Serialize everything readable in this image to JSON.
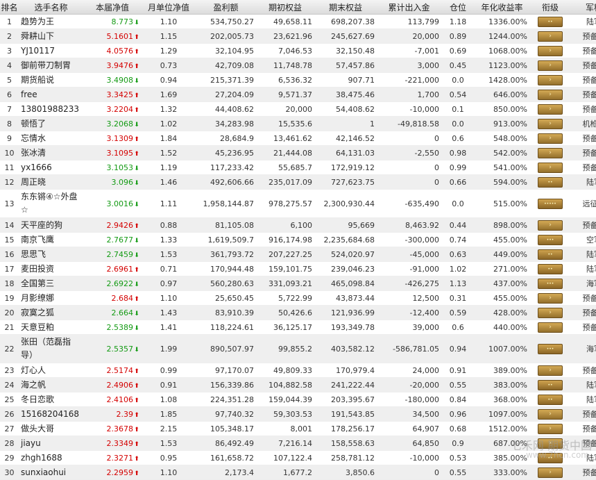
{
  "headers": [
    "排名",
    "选手名称",
    "本届净值",
    "月单位净值",
    "盈利额",
    "期初权益",
    "期末权益",
    "累计出入金",
    "仓位",
    "年化收益率",
    "衔级",
    "军种"
  ],
  "rows": [
    {
      "rank": "1",
      "name": "趋势为王",
      "nav": "8.773",
      "dir": "down",
      "monthly": "1.10",
      "profit": "534,750.27",
      "start": "49,658.11",
      "end": "698,207.38",
      "flow": "113,799",
      "position": "1.18",
      "annual": "1336.00%",
      "badge": "••",
      "branch": "陆军"
    },
    {
      "rank": "2",
      "name": "舜耕山下",
      "nav": "5.1601",
      "dir": "up",
      "monthly": "1.15",
      "profit": "202,005.73",
      "start": "23,621.96",
      "end": "245,627.69",
      "flow": "20,000",
      "position": "0.89",
      "annual": "1244.00%",
      "badge": "›",
      "branch": "预备役"
    },
    {
      "rank": "3",
      "name": "YJ10117",
      "nav": "4.0576",
      "dir": "up",
      "monthly": "1.29",
      "profit": "32,104.95",
      "start": "7,046.53",
      "end": "32,150.48",
      "flow": "-7,001",
      "position": "0.69",
      "annual": "1068.00%",
      "badge": "›",
      "branch": "预备役"
    },
    {
      "rank": "4",
      "name": "御前带刀制胃",
      "nav": "3.9476",
      "dir": "up",
      "monthly": "0.73",
      "profit": "42,709.08",
      "start": "11,748.78",
      "end": "57,457.86",
      "flow": "3,000",
      "position": "0.45",
      "annual": "1123.00%",
      "badge": "›",
      "branch": "预备役"
    },
    {
      "rank": "5",
      "name": "期货船说",
      "nav": "3.4908",
      "dir": "down",
      "monthly": "0.94",
      "profit": "215,371.39",
      "start": "6,536.32",
      "end": "907.71",
      "flow": "-221,000",
      "position": "0.0",
      "annual": "1428.00%",
      "badge": "›",
      "branch": "预备役"
    },
    {
      "rank": "6",
      "name": "free",
      "nav": "3.3425",
      "dir": "up",
      "monthly": "1.69",
      "profit": "27,204.09",
      "start": "9,571.37",
      "end": "38,475.46",
      "flow": "1,700",
      "position": "0.54",
      "annual": "646.00%",
      "badge": "›",
      "branch": "预备役"
    },
    {
      "rank": "7",
      "name": "13801988233",
      "nav": "3.2204",
      "dir": "up",
      "monthly": "1.32",
      "profit": "44,408.62",
      "start": "20,000",
      "end": "54,408.62",
      "flow": "-10,000",
      "position": "0.1",
      "annual": "850.00%",
      "badge": "›",
      "branch": "预备役"
    },
    {
      "rank": "8",
      "name": "顿悟了",
      "nav": "3.2068",
      "dir": "down",
      "monthly": "1.02",
      "profit": "34,283.98",
      "start": "15,535.6",
      "end": "1",
      "flow": "-49,818.58",
      "position": "0.0",
      "annual": "913.00%",
      "badge": "›",
      "branch": "机枪手"
    },
    {
      "rank": "9",
      "name": "忘情水",
      "nav": "3.1309",
      "dir": "up",
      "monthly": "1.84",
      "profit": "28,684.9",
      "start": "13,461.62",
      "end": "42,146.52",
      "flow": "0",
      "position": "0.6",
      "annual": "548.00%",
      "badge": "›",
      "branch": "预备役"
    },
    {
      "rank": "10",
      "name": "张冰清",
      "nav": "3.1095",
      "dir": "up",
      "monthly": "1.52",
      "profit": "45,236.95",
      "start": "21,444.08",
      "end": "64,131.03",
      "flow": "-2,550",
      "position": "0.98",
      "annual": "542.00%",
      "badge": "›",
      "branch": "预备役"
    },
    {
      "rank": "11",
      "name": "yx1666",
      "nav": "3.1053",
      "dir": "down",
      "monthly": "1.19",
      "profit": "117,233.42",
      "start": "55,685.7",
      "end": "172,919.12",
      "flow": "0",
      "position": "0.99",
      "annual": "541.00%",
      "badge": "›",
      "branch": "预备役"
    },
    {
      "rank": "12",
      "name": "周正晓",
      "nav": "3.096",
      "dir": "down",
      "monthly": "1.46",
      "profit": "492,606.66",
      "start": "235,017.09",
      "end": "727,623.75",
      "flow": "0",
      "position": "0.66",
      "annual": "594.00%",
      "badge": "••",
      "branch": "陆军"
    },
    {
      "rank": "13",
      "name": "东东锵④☆外盘☆",
      "nav": "3.0016",
      "dir": "down",
      "monthly": "1.11",
      "profit": "1,958,144.87",
      "start": "978,275.57",
      "end": "2,300,930.44",
      "flow": "-635,490",
      "position": "0.0",
      "annual": "515.00%",
      "badge": "•••••",
      "branch": "远征军",
      "tall": true
    },
    {
      "rank": "14",
      "name": "天平座的狗",
      "nav": "2.9426",
      "dir": "up",
      "monthly": "0.88",
      "profit": "81,105.08",
      "start": "6,100",
      "end": "95,669",
      "flow": "8,463.92",
      "position": "0.44",
      "annual": "898.00%",
      "badge": "›",
      "branch": "预备役"
    },
    {
      "rank": "15",
      "name": "南京飞鹰",
      "nav": "2.7677",
      "dir": "down",
      "monthly": "1.33",
      "profit": "1,619,509.7",
      "start": "916,174.98",
      "end": "2,235,684.68",
      "flow": "-300,000",
      "position": "0.74",
      "annual": "455.00%",
      "badge": "•••",
      "branch": "空军"
    },
    {
      "rank": "16",
      "name": "思思飞",
      "nav": "2.7459",
      "dir": "down",
      "monthly": "1.53",
      "profit": "361,793.72",
      "start": "207,227.25",
      "end": "524,020.97",
      "flow": "-45,000",
      "position": "0.63",
      "annual": "449.00%",
      "badge": "••",
      "branch": "陆军"
    },
    {
      "rank": "17",
      "name": "麦田投资",
      "nav": "2.6961",
      "dir": "up",
      "monthly": "0.71",
      "profit": "170,944.48",
      "start": "159,101.75",
      "end": "239,046.23",
      "flow": "-91,000",
      "position": "1.02",
      "annual": "271.00%",
      "badge": "••",
      "branch": "陆军"
    },
    {
      "rank": "18",
      "name": "全国第三",
      "nav": "2.6922",
      "dir": "down",
      "monthly": "0.97",
      "profit": "560,280.63",
      "start": "331,093.21",
      "end": "465,098.84",
      "flow": "-426,275",
      "position": "1.13",
      "annual": "437.00%",
      "badge": "•••",
      "branch": "海军"
    },
    {
      "rank": "19",
      "name": "月影缭娜",
      "nav": "2.684",
      "dir": "up",
      "monthly": "1.10",
      "profit": "25,650.45",
      "start": "5,722.99",
      "end": "43,873.44",
      "flow": "12,500",
      "position": "0.31",
      "annual": "455.00%",
      "badge": "›",
      "branch": "预备役"
    },
    {
      "rank": "20",
      "name": "寂寞之狐",
      "nav": "2.664",
      "dir": "down",
      "monthly": "1.43",
      "profit": "83,910.39",
      "start": "50,426.6",
      "end": "121,936.99",
      "flow": "-12,400",
      "position": "0.59",
      "annual": "428.00%",
      "badge": "›",
      "branch": "预备役"
    },
    {
      "rank": "21",
      "name": "天意豆粕",
      "nav": "2.5389",
      "dir": "down",
      "monthly": "1.41",
      "profit": "118,224.61",
      "start": "36,125.17",
      "end": "193,349.78",
      "flow": "39,000",
      "position": "0.6",
      "annual": "440.00%",
      "badge": "›",
      "branch": "预备役"
    },
    {
      "rank": "22",
      "name": "张田（范磊指导）",
      "nav": "2.5357",
      "dir": "down",
      "monthly": "1.99",
      "profit": "890,507.97",
      "start": "99,855.2",
      "end": "403,582.12",
      "flow": "-586,781.05",
      "position": "0.94",
      "annual": "1007.00%",
      "badge": "•••",
      "branch": "海军",
      "tall": true
    },
    {
      "rank": "23",
      "name": "灯心人",
      "nav": "2.5174",
      "dir": "up",
      "monthly": "0.99",
      "profit": "97,170.07",
      "start": "49,809.33",
      "end": "170,979.4",
      "flow": "24,000",
      "position": "0.91",
      "annual": "389.00%",
      "badge": "›",
      "branch": "预备役"
    },
    {
      "rank": "24",
      "name": "海之帆",
      "nav": "2.4906",
      "dir": "up",
      "monthly": "0.91",
      "profit": "156,339.86",
      "start": "104,882.58",
      "end": "241,222.44",
      "flow": "-20,000",
      "position": "0.55",
      "annual": "383.00%",
      "badge": "••",
      "branch": "陆军"
    },
    {
      "rank": "25",
      "name": "冬日恋歌",
      "nav": "2.4106",
      "dir": "up",
      "monthly": "1.08",
      "profit": "224,351.28",
      "start": "159,044.39",
      "end": "203,395.67",
      "flow": "-180,000",
      "position": "0.84",
      "annual": "368.00%",
      "badge": "••",
      "branch": "陆军"
    },
    {
      "rank": "26",
      "name": "15168204168",
      "nav": "2.39",
      "dir": "up",
      "monthly": "1.85",
      "profit": "97,740.32",
      "start": "59,303.53",
      "end": "191,543.85",
      "flow": "34,500",
      "position": "0.96",
      "annual": "1097.00%",
      "badge": "›",
      "branch": "预备役"
    },
    {
      "rank": "27",
      "name": "做头大哥",
      "nav": "2.3678",
      "dir": "up",
      "monthly": "2.15",
      "profit": "105,348.17",
      "start": "8,001",
      "end": "178,256.17",
      "flow": "64,907",
      "position": "0.68",
      "annual": "1512.00%",
      "badge": "›",
      "branch": "预备役"
    },
    {
      "rank": "28",
      "name": "jiayu",
      "nav": "2.3349",
      "dir": "up",
      "monthly": "1.53",
      "profit": "86,492.49",
      "start": "7,216.14",
      "end": "158,558.63",
      "flow": "64,850",
      "position": "0.9",
      "annual": "687.00%",
      "badge": "›",
      "branch": "预备役"
    },
    {
      "rank": "29",
      "name": "zhgh1688",
      "nav": "2.3271",
      "dir": "up",
      "monthly": "0.95",
      "profit": "161,658.72",
      "start": "107,122.4",
      "end": "258,781.12",
      "flow": "-10,000",
      "position": "0.53",
      "annual": "385.00%",
      "badge": "••",
      "branch": "陆军"
    },
    {
      "rank": "30",
      "name": "sunxiaohui",
      "nav": "2.2959",
      "dir": "up",
      "monthly": "1.10",
      "profit": "2,173.4",
      "start": "1,677.2",
      "end": "3,850.6",
      "flow": "0",
      "position": "0.55",
      "annual": "333.00%",
      "badge": "›",
      "branch": "预备役"
    }
  ],
  "colors": {
    "up": "#d40000",
    "down": "#139a13",
    "badge": "#b08a3e"
  },
  "icons": {
    "up": "arrow-up-icon",
    "down": "arrow-down-icon"
  },
  "watermark": {
    "line1": "七禾网 期货中国",
    "line2": "www.7hcn.com"
  }
}
